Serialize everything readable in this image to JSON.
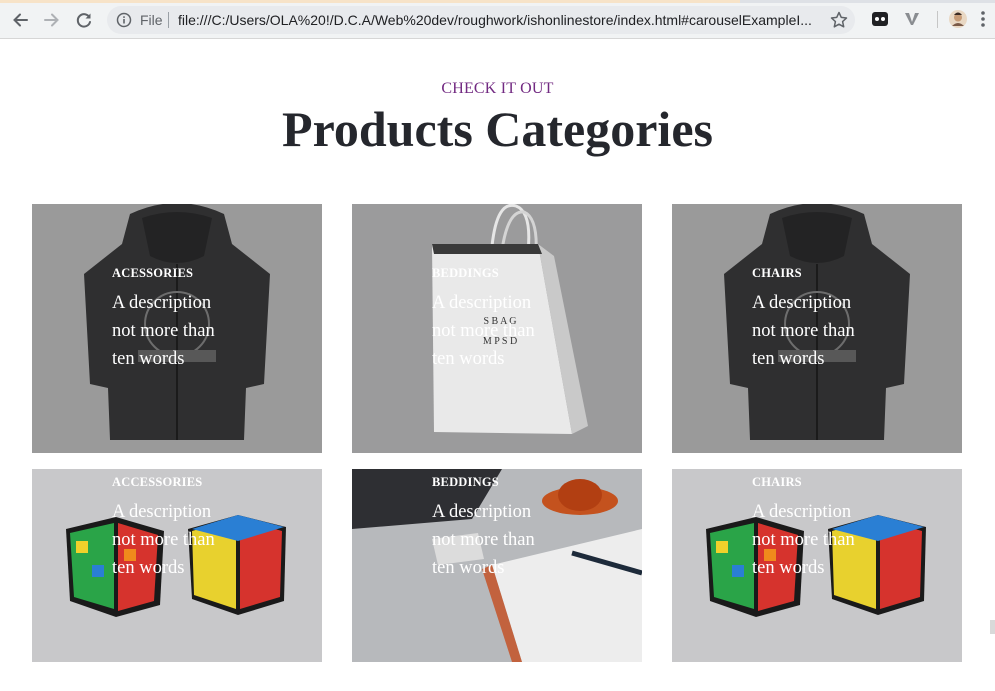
{
  "browser": {
    "scheme_label": "File",
    "url": "file:///C:/Users/OLA%20!/D.C.A/Web%20dev/roughwork/ishonlinestore/index.html#carouselExampleI...",
    "icons": [
      "back-arrow-icon",
      "forward-arrow-icon",
      "reload-icon",
      "info-icon",
      "star-icon",
      "extension-icon",
      "vimeo-extension-icon",
      "profile-avatar-icon",
      "more-vert-icon"
    ]
  },
  "section": {
    "eyebrow": "CHECK IT OUT",
    "title": "Products Categories"
  },
  "colors": {
    "eyebrow": "#722a82",
    "title": "#25272d",
    "card_text": "#ffffff"
  },
  "cards": [
    {
      "title": "ACESSORIES",
      "description": "A description not more than ten words",
      "image": "hoodie"
    },
    {
      "title": "BEDDINGS",
      "description": "A description not more than ten words",
      "image": "shopping-bag"
    },
    {
      "title": "CHAIRS",
      "description": "A description not more than ten words",
      "image": "hoodie"
    },
    {
      "title": "ACCESSORIES",
      "description": "A description not more than ten words",
      "image": "rubiks-cubes"
    },
    {
      "title": "BEDDINGS",
      "description": "A description not more than ten words",
      "image": "desk-notebook"
    },
    {
      "title": "CHAIRS",
      "description": "A description not more than ten words",
      "image": "rubiks-cubes"
    }
  ]
}
